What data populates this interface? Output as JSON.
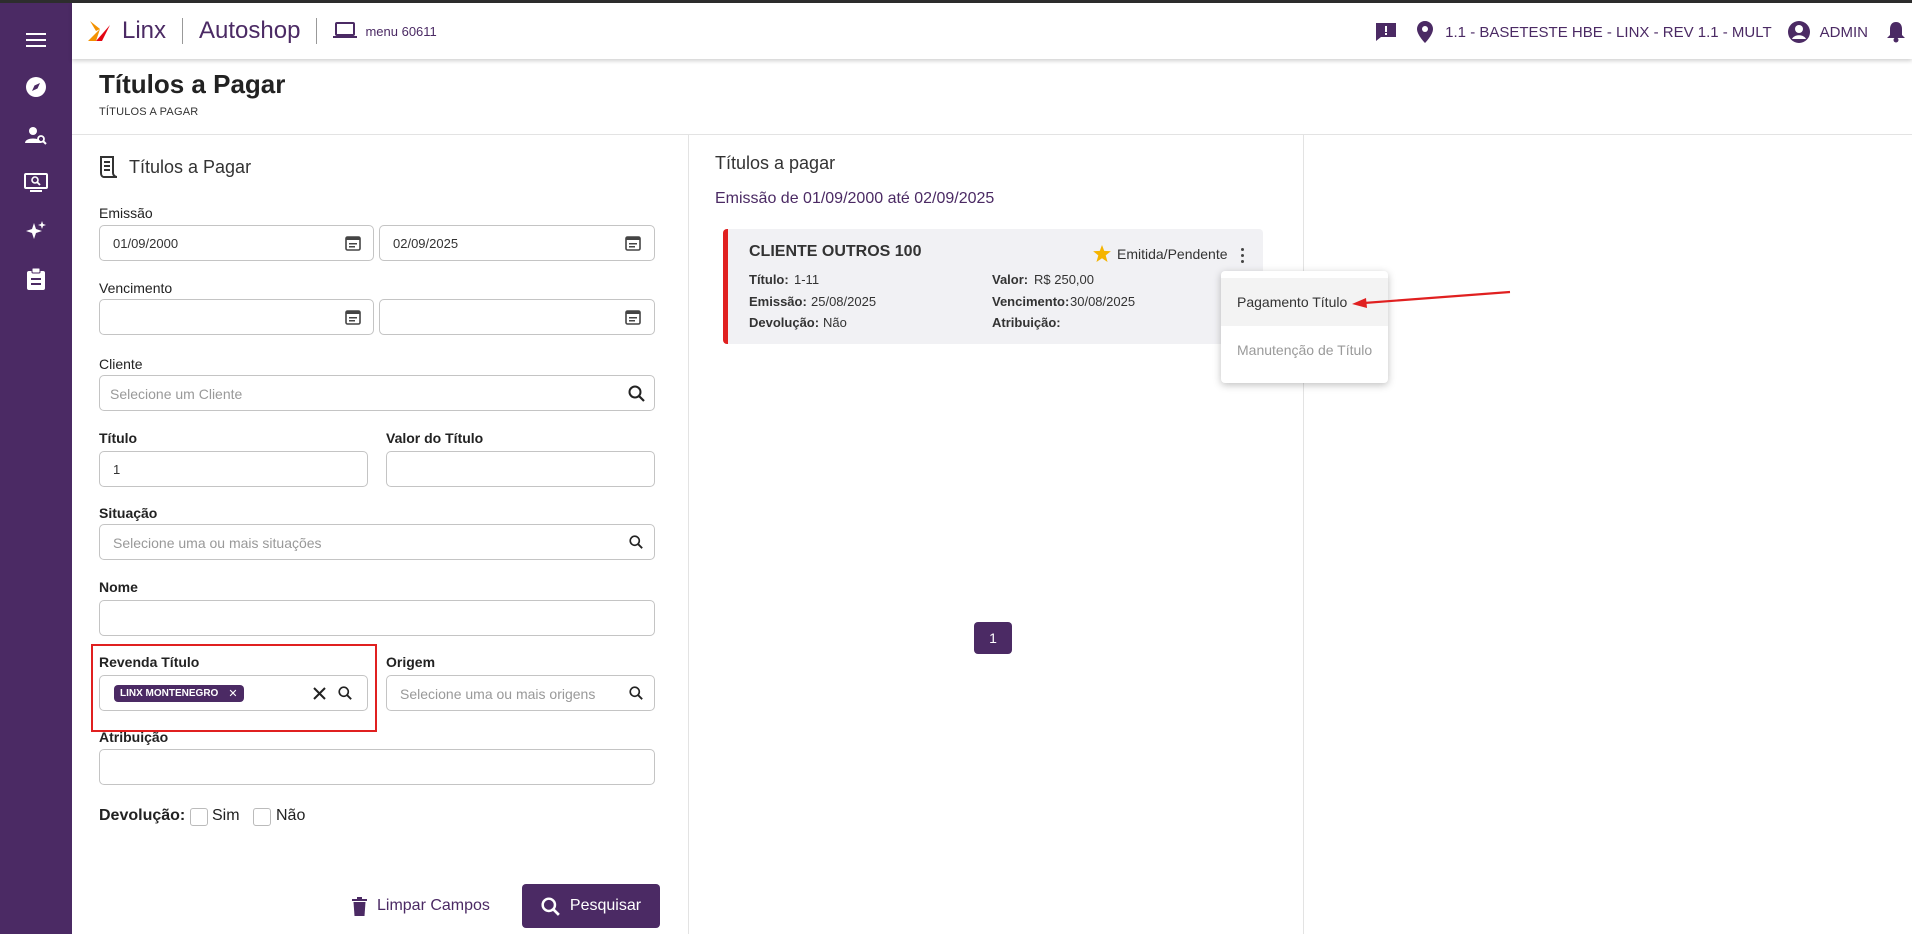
{
  "header": {
    "brand_linx": "Linx",
    "brand_app": "Autoshop",
    "menu_code": "menu 60611",
    "location": "1.1 - BASETESTE HBE - LINX - REV 1.1 - MULT",
    "user": "ADMIN"
  },
  "sidebar": {
    "items": [
      "menu-icon",
      "compass-icon",
      "user-search-icon",
      "monitor-search-icon",
      "sparkles-icon",
      "clipboard-icon"
    ]
  },
  "page": {
    "title": "Títulos a Pagar",
    "breadcrumb": "TÍTULOS A PAGAR"
  },
  "form": {
    "panel_title": "Títulos a Pagar",
    "emissao_label": "Emissão",
    "emissao_start": "01/09/2000",
    "emissao_end": "02/09/2025",
    "vencimento_label": "Vencimento",
    "cliente_label": "Cliente",
    "cliente_placeholder": "Selecione um Cliente",
    "titulo_label": "Título",
    "titulo_value": "1",
    "valor_label": "Valor do Título",
    "situacao_label": "Situação",
    "situacao_placeholder": "Selecione uma ou mais situações",
    "nome_label": "Nome",
    "revenda_label": "Revenda Título",
    "revenda_chip": "LINX MONTENEGRO",
    "origem_label": "Origem",
    "origem_placeholder": "Selecione uma ou mais origens",
    "atribuicao_label": "Atribuição",
    "devolucao_label": "Devolução:",
    "devolucao_sim": "Sim",
    "devolucao_nao": "Não",
    "clear_label": "Limpar Campos",
    "search_label": "Pesquisar"
  },
  "results": {
    "title": "Títulos a pagar",
    "subtitle": "Emissão de 01/09/2000 até 02/09/2025",
    "card": {
      "name": "CLIENTE OUTROS 100",
      "status": "Emitida/Pendente",
      "titulo_k": "Título:",
      "titulo_v": "1-11",
      "emissao_k": "Emissão:",
      "emissao_v": "25/08/2025",
      "devolucao_k": "Devolução:",
      "devolucao_v": "Não",
      "valor_k": "Valor:",
      "valor_v": "R$ 250,00",
      "vencimento_k": "Vencimento:",
      "vencimento_v": "30/08/2025",
      "atribuicao_k": "Atribuição:"
    },
    "menu": [
      "Pagamento Título",
      "Manutenção de Título"
    ],
    "page": "1"
  },
  "colors": {
    "primary": "#4b2a64",
    "accent_red": "#e02020",
    "star": "#f5b400"
  }
}
